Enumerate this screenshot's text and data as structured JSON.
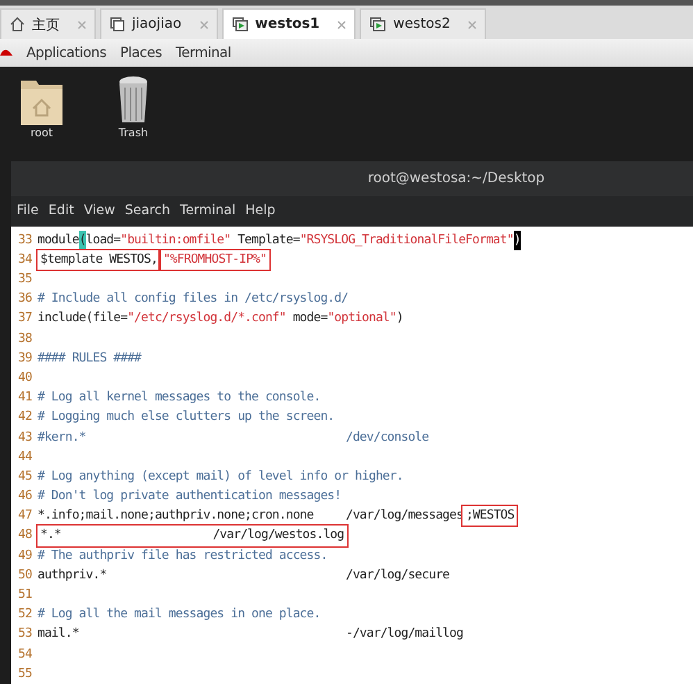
{
  "browser_tabs": [
    {
      "label": "主页",
      "kind": "home",
      "selected": false
    },
    {
      "label": "jiaojiao",
      "kind": "window",
      "selected": false
    },
    {
      "label": "westos1",
      "kind": "vm",
      "selected": true
    },
    {
      "label": "westos2",
      "kind": "vm",
      "selected": false
    }
  ],
  "top_menu": [
    "Applications",
    "Places",
    "Terminal"
  ],
  "desktop_icons": [
    {
      "label": "root",
      "kind": "folder"
    },
    {
      "label": "Trash",
      "kind": "trash"
    }
  ],
  "terminal": {
    "title": "root@westosa:~/Desktop",
    "menu": [
      "File",
      "Edit",
      "View",
      "Search",
      "Terminal",
      "Help"
    ],
    "lines": [
      {
        "number": "33",
        "segments": [
          {
            "text": "module",
            "kind": "code",
            "boxed": false
          },
          {
            "text": "(",
            "kind": "match",
            "boxed": false
          },
          {
            "text": "load=",
            "kind": "code",
            "boxed": false
          },
          {
            "text": "\"builtin:omfile\"",
            "kind": "string",
            "boxed": false
          },
          {
            "text": " Template=",
            "kind": "code",
            "boxed": false
          },
          {
            "text": "\"RSYSLOG_TraditionalFileFormat\"",
            "kind": "string",
            "boxed": false
          },
          {
            "text": ")",
            "kind": "cursor",
            "boxed": false
          }
        ]
      },
      {
        "number": "34",
        "segments": [
          {
            "text": "$template WESTOS,",
            "kind": "code",
            "boxed": true
          },
          {
            "text": "\"%FROMHOST-IP%\"",
            "kind": "string",
            "boxed": true
          }
        ]
      },
      {
        "number": "35"
      },
      {
        "number": "36",
        "segments": [
          {
            "text": "# Include all config files in /etc/rsyslog.d/",
            "kind": "comment",
            "boxed": false
          }
        ]
      },
      {
        "number": "37",
        "segments": [
          {
            "text": "include(file=",
            "kind": "code",
            "boxed": false
          },
          {
            "text": "\"/etc/rsyslog.d/*.conf\"",
            "kind": "string",
            "boxed": false
          },
          {
            "text": " mode=",
            "kind": "code",
            "boxed": false
          },
          {
            "text": "\"optional\"",
            "kind": "string",
            "boxed": false
          },
          {
            "text": ")",
            "kind": "code",
            "boxed": false
          }
        ]
      },
      {
        "number": "38"
      },
      {
        "number": "39",
        "segments": [
          {
            "text": "#### RULES ####",
            "kind": "comment",
            "boxed": false
          }
        ]
      },
      {
        "number": "40"
      },
      {
        "number": "41",
        "segments": [
          {
            "text": "# Log all kernel messages to the console.",
            "kind": "comment",
            "boxed": false
          }
        ]
      },
      {
        "number": "42",
        "segments": [
          {
            "text": "# Logging much else clutters up the screen.",
            "kind": "comment",
            "boxed": false
          }
        ]
      },
      {
        "number": "43",
        "segments": [
          {
            "text": "#kern.*",
            "kind": "comment",
            "boxed": false
          }
        ],
        "action": [
          {
            "text": "/dev/console",
            "kind": "comment",
            "boxed": false
          }
        ]
      },
      {
        "number": "44"
      },
      {
        "number": "45",
        "segments": [
          {
            "text": "# Log anything (except mail) of level info or higher.",
            "kind": "comment",
            "boxed": false
          }
        ]
      },
      {
        "number": "46",
        "segments": [
          {
            "text": "# Don't log private authentication messages!",
            "kind": "comment",
            "boxed": false
          }
        ]
      },
      {
        "number": "47",
        "segments": [
          {
            "text": "*.info;mail.none;authpriv.none;cron.none",
            "kind": "code",
            "boxed": false
          }
        ],
        "action": [
          {
            "text": "/var/log/messages",
            "kind": "code",
            "boxed": false
          },
          {
            "text": ";WESTOS",
            "kind": "code",
            "boxed": true
          }
        ]
      },
      {
        "number": "48",
        "segments": [
          {
            "text": "*.*                      /var/log/westos.log",
            "kind": "code",
            "boxed": true
          }
        ]
      },
      {
        "number": "49",
        "segments": [
          {
            "text": "# The authpriv file has restricted access.",
            "kind": "comment",
            "boxed": false
          }
        ]
      },
      {
        "number": "50",
        "segments": [
          {
            "text": "authpriv.*",
            "kind": "code",
            "boxed": false
          }
        ],
        "action": [
          {
            "text": "/var/log/secure",
            "kind": "code",
            "boxed": false
          }
        ]
      },
      {
        "number": "51"
      },
      {
        "number": "52",
        "segments": [
          {
            "text": "# Log all the mail messages in one place.",
            "kind": "comment",
            "boxed": false
          }
        ]
      },
      {
        "number": "53",
        "segments": [
          {
            "text": "mail.*",
            "kind": "code",
            "boxed": false
          }
        ],
        "action": [
          {
            "text": "-/var/log/maillog",
            "kind": "code",
            "boxed": false
          }
        ]
      },
      {
        "number": "54"
      },
      {
        "number": "55"
      }
    ]
  }
}
